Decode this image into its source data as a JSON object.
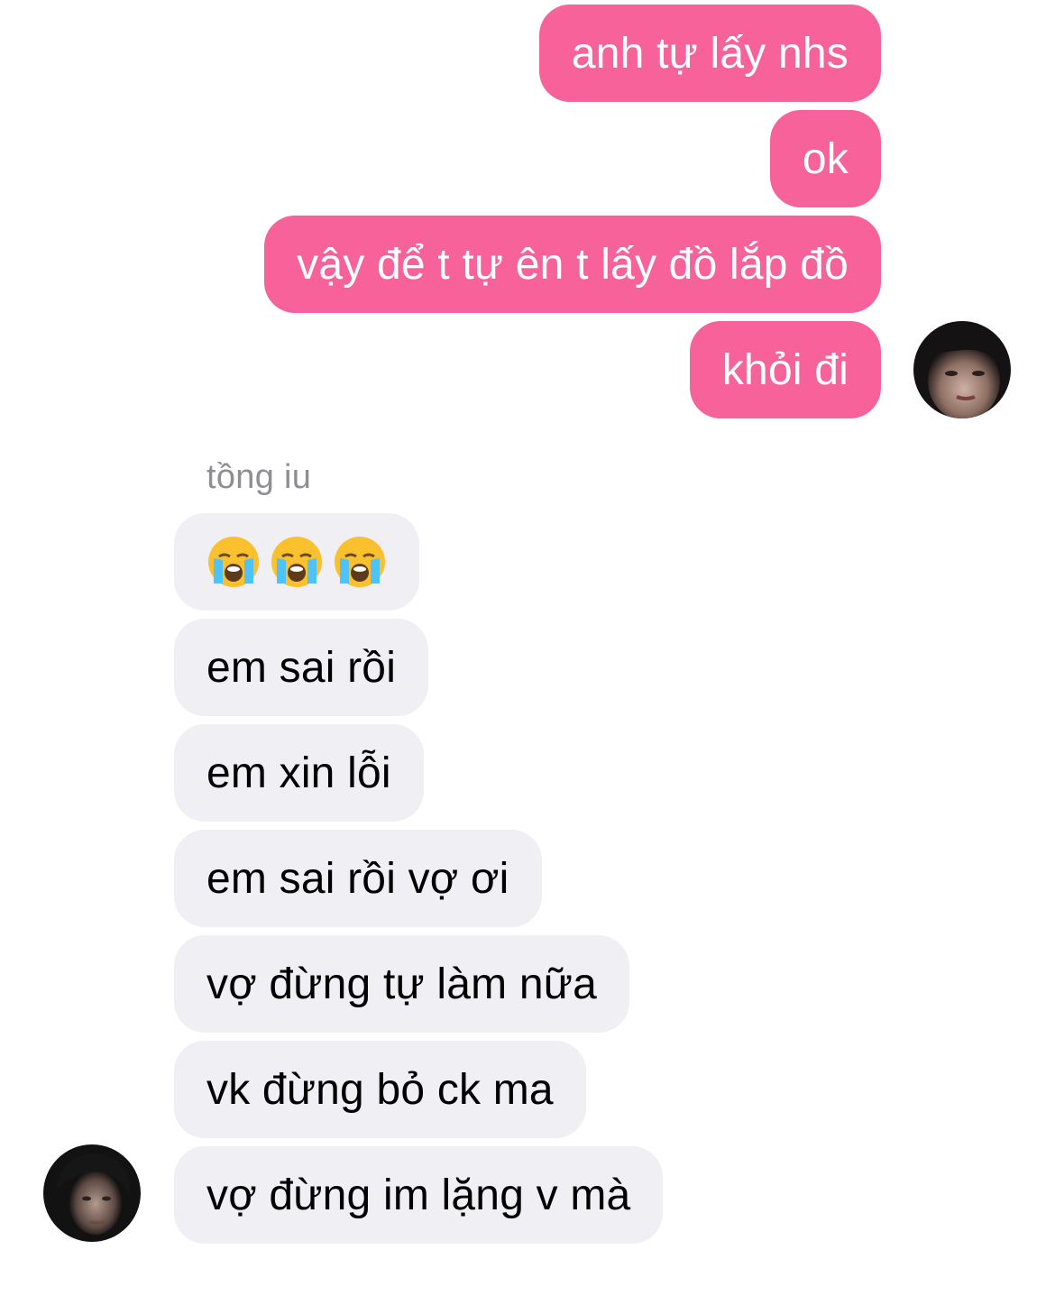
{
  "outgoing": [
    {
      "text": "anh tự lấy nhs"
    },
    {
      "text": "ok"
    },
    {
      "text": "vậy để t tự ên t lấy đồ lắp đồ"
    },
    {
      "text": "khỏi đi"
    }
  ],
  "incoming_sender": "tồng iu",
  "incoming": [
    {
      "emojis": [
        "loudly-crying-face",
        "loudly-crying-face",
        "loudly-crying-face"
      ]
    },
    {
      "text": "em sai rồi"
    },
    {
      "text": "em xin lỗi"
    },
    {
      "text": "em sai rồi vợ ơi"
    },
    {
      "text": "vợ đừng tự làm nữa"
    },
    {
      "text": "vk đừng bỏ ck ma"
    },
    {
      "text": "vợ đừng im lặng v mà"
    }
  ],
  "colors": {
    "outgoing_bubble": "#f7629b",
    "incoming_bubble": "#efeff4",
    "sender_name": "#8e8e93"
  }
}
